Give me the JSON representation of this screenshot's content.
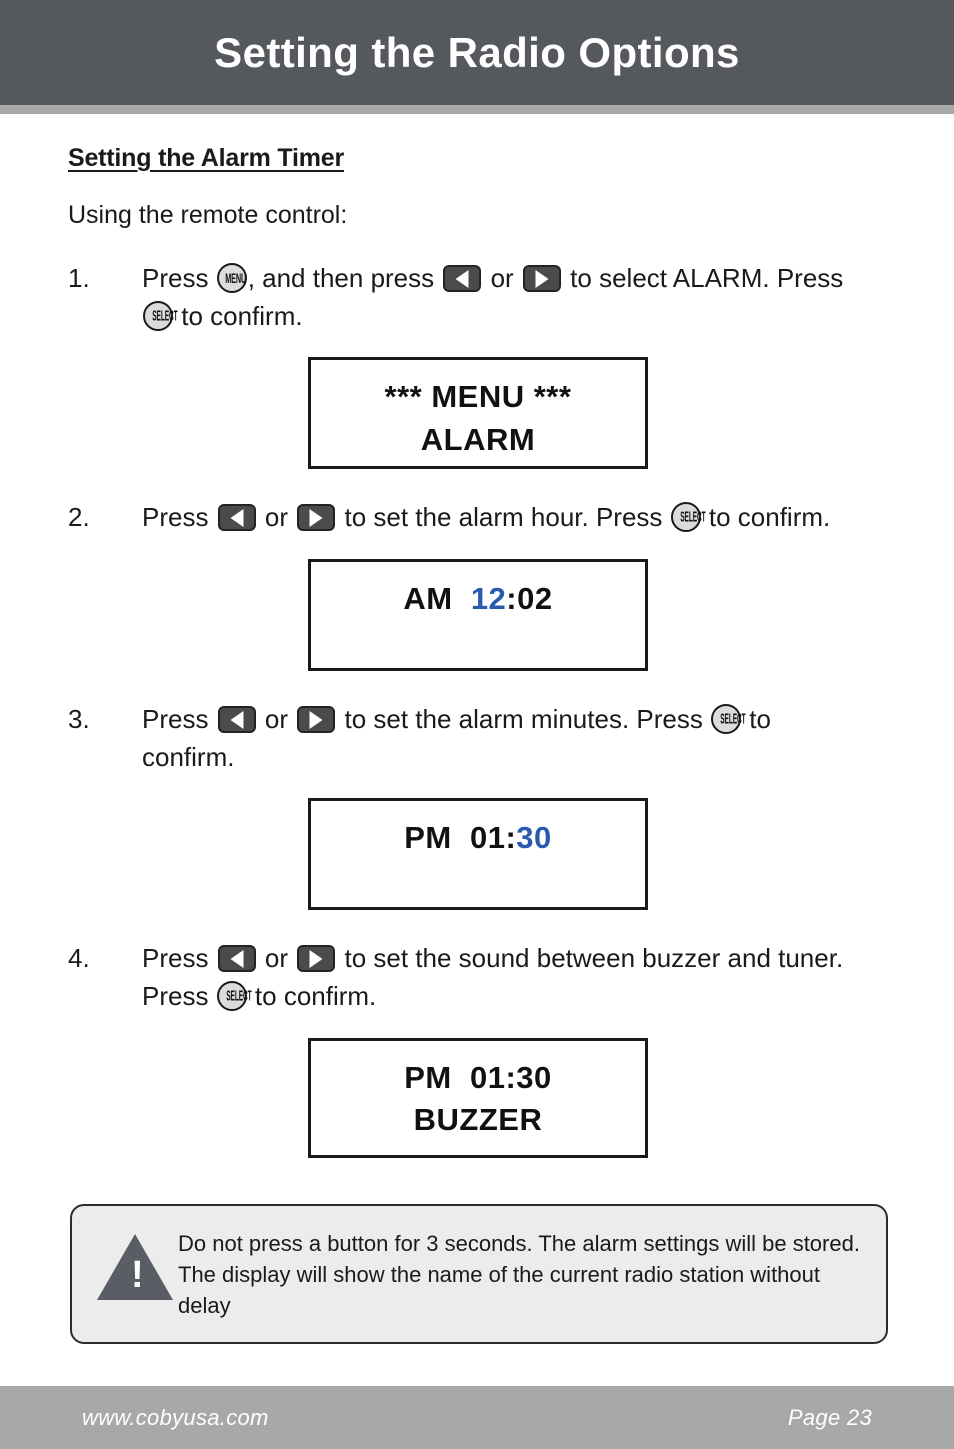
{
  "header": {
    "title": "Setting the Radio Options"
  },
  "section": {
    "heading": "Setting the Alarm Timer",
    "intro": "Using the remote control:"
  },
  "icons": {
    "menu_label": "MENU",
    "select_label": "SELECT",
    "left_arrow": "left-arrow-button-icon",
    "right_arrow": "right-arrow-button-icon",
    "warning": "warning-triangle-icon",
    "warning_glyph": "!"
  },
  "steps": [
    {
      "number": "1.",
      "text_parts": [
        "Press ",
        ", and then press ",
        " or ",
        " to select ALARM. Press ",
        " to confirm."
      ],
      "display": {
        "line1": "*** MENU ***",
        "line2": "ALARM",
        "line1_highlight": "",
        "line2_highlight": ""
      }
    },
    {
      "number": "2.",
      "text_parts": [
        "Press ",
        " or ",
        " to set the alarm hour. Press ",
        " to confirm."
      ],
      "display": {
        "line1_pre": "AM  ",
        "line1_highlight": "12",
        "line1_post": ":02",
        "line2": ""
      }
    },
    {
      "number": "3.",
      "text_parts": [
        "Press ",
        " or ",
        " to set the alarm minutes. Press ",
        " to confirm."
      ],
      "display": {
        "line1_pre": "PM  01:",
        "line1_highlight": "30",
        "line1_post": "",
        "line2": ""
      }
    },
    {
      "number": "4.",
      "text_parts": [
        "Press ",
        " or ",
        " to set the sound between buzzer and tuner. Press ",
        " to confirm."
      ],
      "display": {
        "line1_pre": "PM  01:30",
        "line1_highlight": "",
        "line1_post": "",
        "line2": "BUZZER"
      }
    }
  ],
  "note": {
    "text": "Do not press a button for 3 seconds.  The alarm settings will be stored.  The display will show the name of the current radio station without delay"
  },
  "footer": {
    "website": "www.cobyusa.com",
    "page": "Page 23"
  },
  "colors": {
    "header_bg": "#55585d",
    "rule_bg": "#a8a8a8",
    "footer_bg": "#a8a8a8",
    "highlight_blue": "#2a5aad",
    "note_bg": "#ececec",
    "warning_gray": "#5a5e64"
  }
}
